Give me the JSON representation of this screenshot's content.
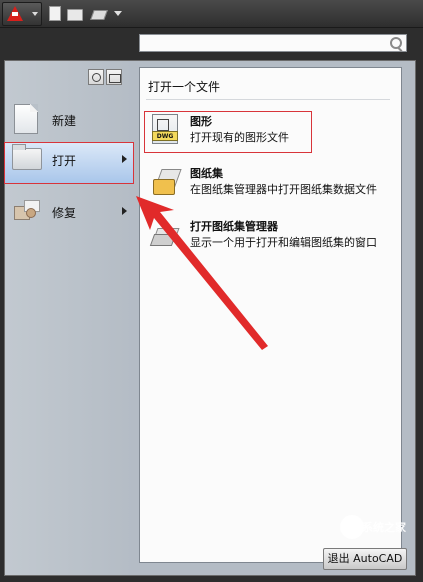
{
  "toolbar": {
    "app_icon": "autocad-logo-icon",
    "quick_access": [
      "new-doc-icon",
      "open-folder-icon",
      "save-icon",
      "chevron-down-icon"
    ]
  },
  "search": {
    "placeholder": ""
  },
  "sidebar": {
    "items": [
      {
        "label": "新建",
        "icon": "new-document-icon"
      },
      {
        "label": "打开",
        "icon": "open-folder-icon",
        "has_submenu": true,
        "selected": true
      },
      {
        "label": "修复",
        "icon": "repair-icon",
        "has_submenu": true
      }
    ]
  },
  "content": {
    "title": "打开一个文件",
    "options": [
      {
        "title": "图形",
        "desc": "打开现有的图形文件",
        "icon": "dwg-file-icon",
        "badge": "DWG"
      },
      {
        "title": "图纸集",
        "desc": "在图纸集管理器中打开图纸集数据文件",
        "icon": "sheet-set-icon"
      },
      {
        "title": "打开图纸集管理器",
        "desc": "显示一个用于打开和编辑图纸集的窗口",
        "icon": "sheet-set-manager-icon"
      }
    ]
  },
  "footer": {
    "exit_label": "退出 AutoCAD"
  },
  "watermark": {
    "text": "系统之家"
  },
  "colors": {
    "accent_red": "#d8343a",
    "panel": "#b7bec6",
    "highlight": "#a9c6ea"
  }
}
